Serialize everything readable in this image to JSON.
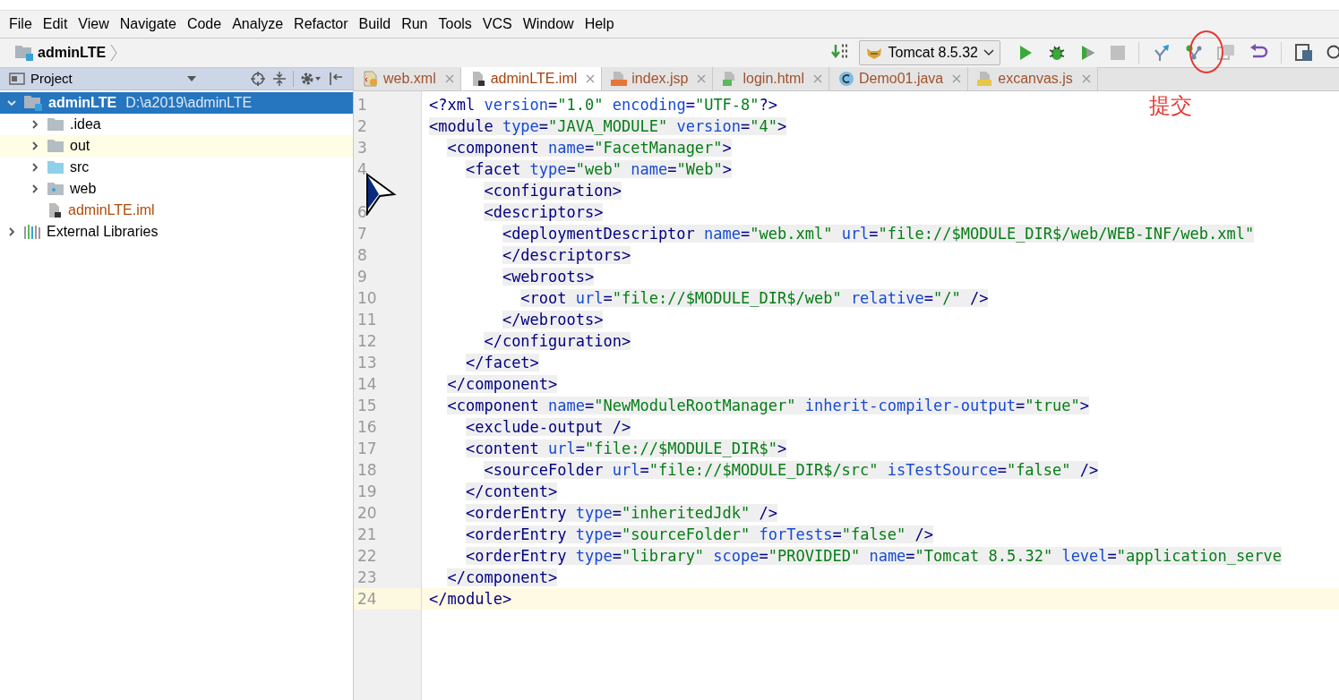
{
  "menu": [
    {
      "label": "File"
    },
    {
      "label": "Edit"
    },
    {
      "label": "View"
    },
    {
      "label": "Navigate"
    },
    {
      "label": "Code"
    },
    {
      "label": "Analyze"
    },
    {
      "label": "Refactor"
    },
    {
      "label": "Build"
    },
    {
      "label": "Run"
    },
    {
      "label": "Tools"
    },
    {
      "label": "VCS"
    },
    {
      "label": "Window"
    },
    {
      "label": "Help"
    }
  ],
  "breadcrumb": {
    "label": "adminLTE"
  },
  "run_config": {
    "label": "Tomcat 8.5.32"
  },
  "toolbar": [
    {
      "kind": "build",
      "disabled": false
    },
    {
      "kind": "run",
      "disabled": false
    },
    {
      "kind": "debug",
      "disabled": false
    },
    {
      "kind": "coverage",
      "disabled": false
    },
    {
      "kind": "stop",
      "disabled": true
    },
    {
      "kind": "update",
      "disabled": false
    },
    {
      "kind": "commit",
      "disabled": false
    },
    {
      "kind": "compare",
      "disabled": true
    },
    {
      "kind": "revert",
      "disabled": false
    },
    {
      "kind": "structure",
      "disabled": false
    },
    {
      "kind": "search",
      "disabled": false
    }
  ],
  "annotation": {
    "label": "提交"
  },
  "project_panel": {
    "title": "Project",
    "tree": [
      {
        "label": "adminLTE",
        "path": "D:\\a2019\\adminLTE",
        "kind": "module",
        "expanded": true,
        "selected": true,
        "children": [
          {
            "label": ".idea",
            "kind": "folder",
            "expanded": false,
            "selected": false,
            "excluded": false
          },
          {
            "label": "out",
            "kind": "folder",
            "expanded": false,
            "selected": false,
            "excluded": true
          },
          {
            "label": "src",
            "kind": "source",
            "expanded": false,
            "selected": false,
            "excluded": false
          },
          {
            "label": "web",
            "kind": "web",
            "expanded": false,
            "selected": false,
            "excluded": false
          },
          {
            "label": "adminLTE.iml",
            "kind": "iml",
            "selected": false,
            "excluded": false
          }
        ]
      },
      {
        "label": "External Libraries",
        "kind": "libraries",
        "expanded": false,
        "selected": false
      }
    ]
  },
  "tabs": [
    {
      "label": "web.xml",
      "kind": "xml",
      "selected": false
    },
    {
      "label": "adminLTE.iml",
      "kind": "iml",
      "selected": true
    },
    {
      "label": "index.jsp",
      "kind": "jsp",
      "selected": false
    },
    {
      "label": "login.html",
      "kind": "html",
      "selected": false
    },
    {
      "label": "Demo01.java",
      "kind": "java",
      "selected": false
    },
    {
      "label": "excanvas.js",
      "kind": "js",
      "selected": false
    }
  ],
  "editor": {
    "lines": [
      {
        "number": "1",
        "text": "<?xml version=\"1.0\" encoding=\"UTF-8\"?>",
        "highlighted": false,
        "current": false
      },
      {
        "number": "2",
        "text": "<module type=\"JAVA_MODULE\" version=\"4\">",
        "highlighted": true,
        "current": false
      },
      {
        "number": "3",
        "text": "  <component name=\"FacetManager\">",
        "highlighted": true,
        "current": false
      },
      {
        "number": "4",
        "text": "    <facet type=\"web\" name=\"Web\">",
        "highlighted": true,
        "current": false
      },
      {
        "text": "      <configuration>",
        "highlighted": true,
        "current": false
      },
      {
        "number": "6",
        "text": "      <descriptors>",
        "highlighted": true,
        "current": false
      },
      {
        "number": "7",
        "text": "        <deploymentDescriptor name=\"web.xml\" url=\"file://$MODULE_DIR$/web/WEB-INF/web.xml\"",
        "highlighted": true,
        "current": false
      },
      {
        "number": "8",
        "text": "        </descriptors>",
        "highlighted": true,
        "current": false
      },
      {
        "number": "9",
        "text": "        <webroots>",
        "highlighted": true,
        "current": false
      },
      {
        "number": "10",
        "text": "          <root url=\"file://$MODULE_DIR$/web\" relative=\"/\" />",
        "highlighted": true,
        "current": false
      },
      {
        "number": "11",
        "text": "        </webroots>",
        "highlighted": true,
        "current": false
      },
      {
        "number": "12",
        "text": "      </configuration>",
        "highlighted": true,
        "current": false
      },
      {
        "number": "13",
        "text": "    </facet>",
        "highlighted": true,
        "current": false
      },
      {
        "number": "14",
        "text": "  </component>",
        "highlighted": true,
        "current": false
      },
      {
        "number": "15",
        "text": "  <component name=\"NewModuleRootManager\" inherit-compiler-output=\"true\">",
        "highlighted": true,
        "current": false
      },
      {
        "number": "16",
        "text": "    <exclude-output />",
        "highlighted": true,
        "current": false
      },
      {
        "number": "17",
        "text": "    <content url=\"file://$MODULE_DIR$\">",
        "highlighted": true,
        "current": false
      },
      {
        "number": "18",
        "text": "      <sourceFolder url=\"file://$MODULE_DIR$/src\" isTestSource=\"false\" />",
        "highlighted": true,
        "current": false
      },
      {
        "number": "19",
        "text": "    </content>",
        "highlighted": true,
        "current": false
      },
      {
        "number": "20",
        "text": "    <orderEntry type=\"inheritedJdk\" />",
        "highlighted": true,
        "current": false
      },
      {
        "number": "21",
        "text": "    <orderEntry type=\"sourceFolder\" forTests=\"false\" />",
        "highlighted": true,
        "current": false
      },
      {
        "number": "22",
        "text": "    <orderEntry type=\"library\" scope=\"PROVIDED\" name=\"Tomcat 8.5.32\" level=\"application_serve",
        "highlighted": true,
        "current": false
      },
      {
        "number": "23",
        "text": "  </component>",
        "highlighted": true,
        "current": false
      },
      {
        "number": "24",
        "text": "</module>",
        "highlighted": false,
        "current": true
      }
    ]
  }
}
